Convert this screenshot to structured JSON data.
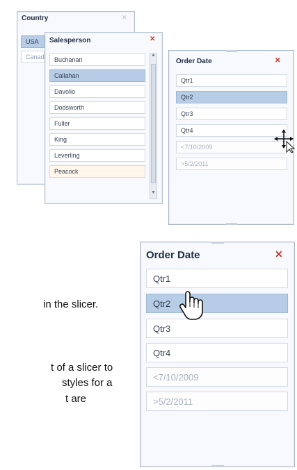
{
  "country_slicer": {
    "title": "Country",
    "items": [
      "USA",
      "Canad"
    ]
  },
  "salesperson_slicer": {
    "title": "Salesperson",
    "items": [
      "Buchanan",
      "Callahan",
      "Davolio",
      "Dodsworth",
      "Fuller",
      "King",
      "Leverling",
      "Peacock"
    ]
  },
  "order_date_small": {
    "title": "Order Date",
    "items": [
      "Qtr1",
      "Qtr2",
      "Qtr3",
      "Qtr4",
      "<7/10/2009",
      ">5/2/2011"
    ]
  },
  "order_date_large": {
    "title": "Order Date",
    "items": [
      "Qtr1",
      "Qtr2",
      "Qtr3",
      "Qtr4",
      "<7/10/2009",
      ">5/2/2011"
    ]
  },
  "body_text": {
    "line1": "in the slicer.",
    "line2": "t of a slicer to",
    "line3": "styles for a",
    "line4": "t are"
  },
  "icons": {
    "clear_filter": "clear-filter-icon",
    "move_cursor": "move-cursor-icon",
    "hand_cursor": "hand-pointer-icon"
  }
}
